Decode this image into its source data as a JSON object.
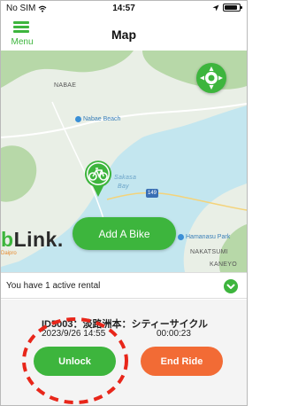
{
  "status_bar": {
    "carrier": "No SIM",
    "time": "14:57",
    "battery_level": 0.9
  },
  "header": {
    "menu_label": "Menu",
    "title": "Map"
  },
  "map": {
    "labels": {
      "area_nabae": "NABAE",
      "beach": "Nabae Beach",
      "bay_1": "Sakasa",
      "bay_2": "Bay",
      "park": "Hamanasu Park",
      "nakatsumi": "NAKATSUMI",
      "kaneyo": "KANEYO",
      "road_number": "149"
    },
    "add_bike_label": "Add A Bike",
    "logo_prefix": "b",
    "logo_rest": "Link.",
    "logo_sub": "Daipro",
    "colors": {
      "water": "#c3e6ef",
      "land": "#e9efe6",
      "green_area": "#b7d8a8",
      "accent": "#3db53d"
    }
  },
  "rental_bar": {
    "text": "You have 1 active rental"
  },
  "rental": {
    "bike_name": "ID5003：淡路洲本：シティーサイクル",
    "start_time": "2023/9/26 14:55",
    "elapsed": "00:00:23",
    "unlock_label": "Unlock",
    "end_ride_label": "End Ride",
    "colors": {
      "unlock": "#3db53d",
      "end_ride": "#f26b35",
      "highlight": "#e8261a"
    }
  }
}
